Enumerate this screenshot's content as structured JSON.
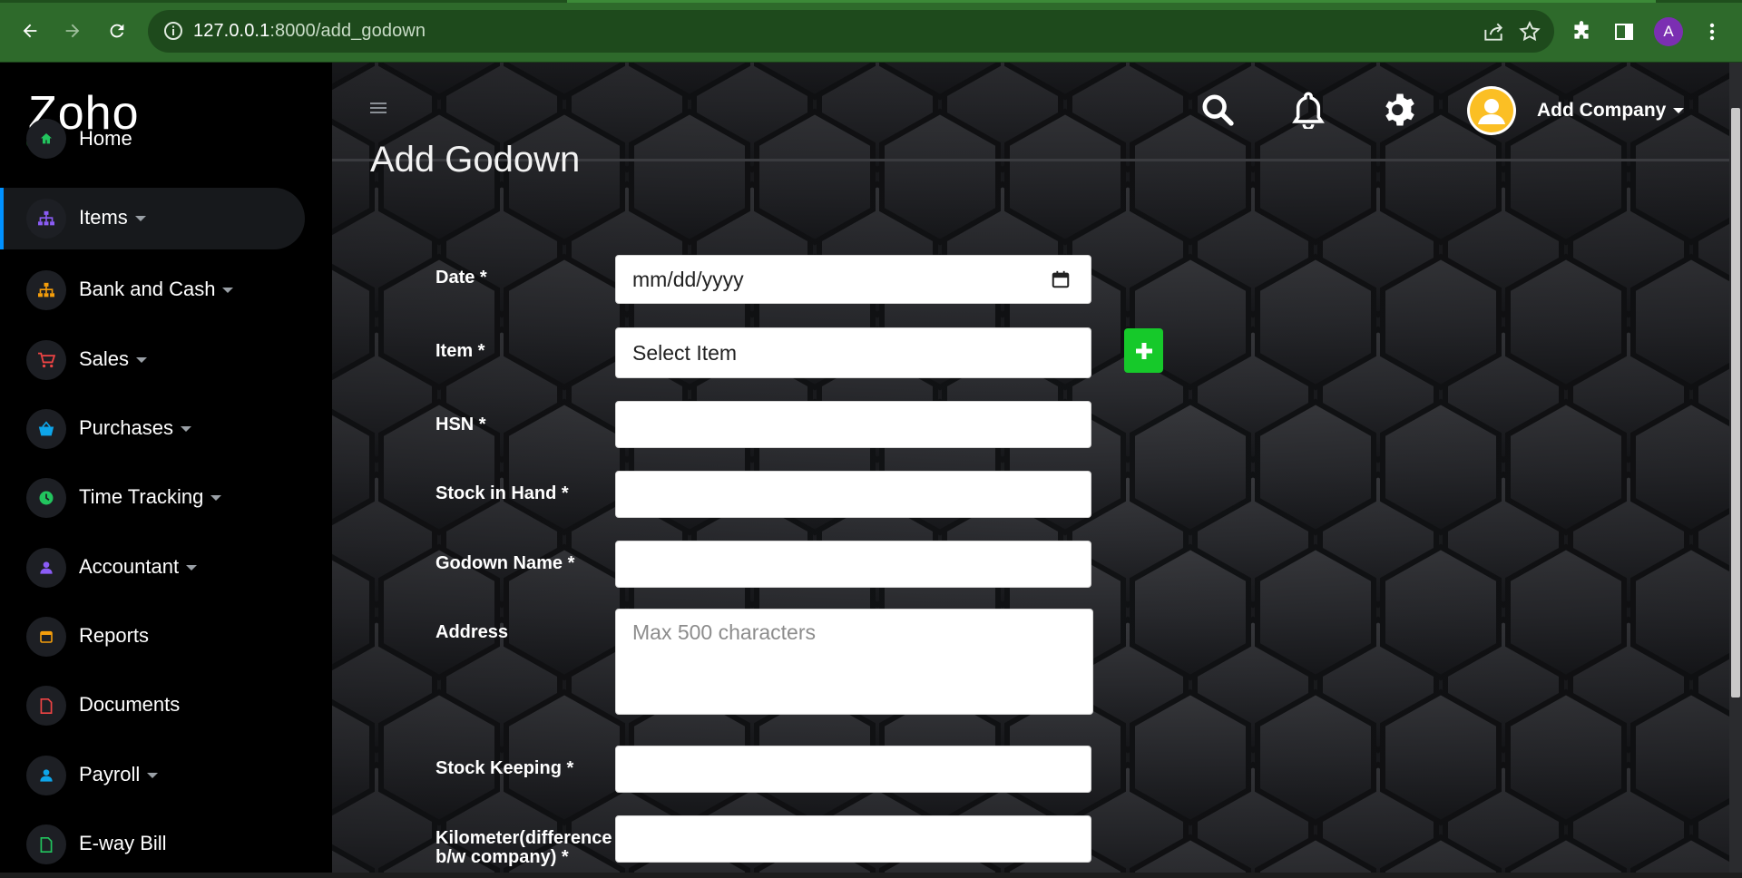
{
  "browser": {
    "url_host": "127.0.0.1",
    "url_path": ":8000/add_godown",
    "profile_initial": "A",
    "icons": [
      "back-icon",
      "forward-icon",
      "reload-icon",
      "info-icon",
      "share-icon",
      "star-icon",
      "extensions-icon",
      "side-panel-icon",
      "menu-icon"
    ]
  },
  "sidebar": {
    "brand": "Zoho",
    "items": [
      {
        "label": "Home",
        "icon": "home-icon",
        "color": "#22c55e",
        "has_caret": false
      },
      {
        "label": "Items",
        "icon": "sitemap-icon",
        "color": "#8b5cf6",
        "has_caret": true,
        "active": true
      },
      {
        "label": "Bank and Cash",
        "icon": "sitemap-icon",
        "color": "#f59e0b",
        "has_caret": true
      },
      {
        "label": "Sales",
        "icon": "cart-icon",
        "color": "#ef4444",
        "has_caret": true
      },
      {
        "label": "Purchases",
        "icon": "basket-icon",
        "color": "#0ea5e9",
        "has_caret": true
      },
      {
        "label": "Time Tracking",
        "icon": "clock-icon",
        "color": "#22c55e",
        "has_caret": true
      },
      {
        "label": "Accountant",
        "icon": "person-icon",
        "color": "#8b5cf6",
        "has_caret": true
      },
      {
        "label": "Reports",
        "icon": "calendar-icon",
        "color": "#f59e0b",
        "has_caret": false
      },
      {
        "label": "Documents",
        "icon": "document-icon",
        "color": "#ef4444",
        "has_caret": false
      },
      {
        "label": "Payroll",
        "icon": "person-icon",
        "color": "#0ea5e9",
        "has_caret": true
      },
      {
        "label": "E-way Bill",
        "icon": "document-icon",
        "color": "#22c55e",
        "has_caret": false
      }
    ]
  },
  "header": {
    "company_label": "Add Company",
    "icons": [
      "search-icon",
      "bell-icon",
      "gear-icon",
      "avatar-icon"
    ]
  },
  "page": {
    "title": "Add Godown"
  },
  "form": {
    "date_label": "Date *",
    "date_value": "mm/dd/yyyy",
    "item_label": "Item *",
    "item_value": "Select Item",
    "hsn_label": "HSN *",
    "hsn_value": "",
    "stock_label": "Stock in Hand *",
    "stock_value": "",
    "godown_label": "Godown Name *",
    "godown_value": "",
    "address_label": "Address",
    "address_placeholder": "Max 500 characters",
    "keeping_label": "Stock Keeping *",
    "keeping_value": "",
    "km_label_1": "Kilometer(difference",
    "km_label_2": "b/w company) *",
    "km_value": ""
  },
  "colors": {
    "chrome": "#2e6a2b",
    "accent": "#0091ff",
    "add_button": "#16c92a"
  }
}
